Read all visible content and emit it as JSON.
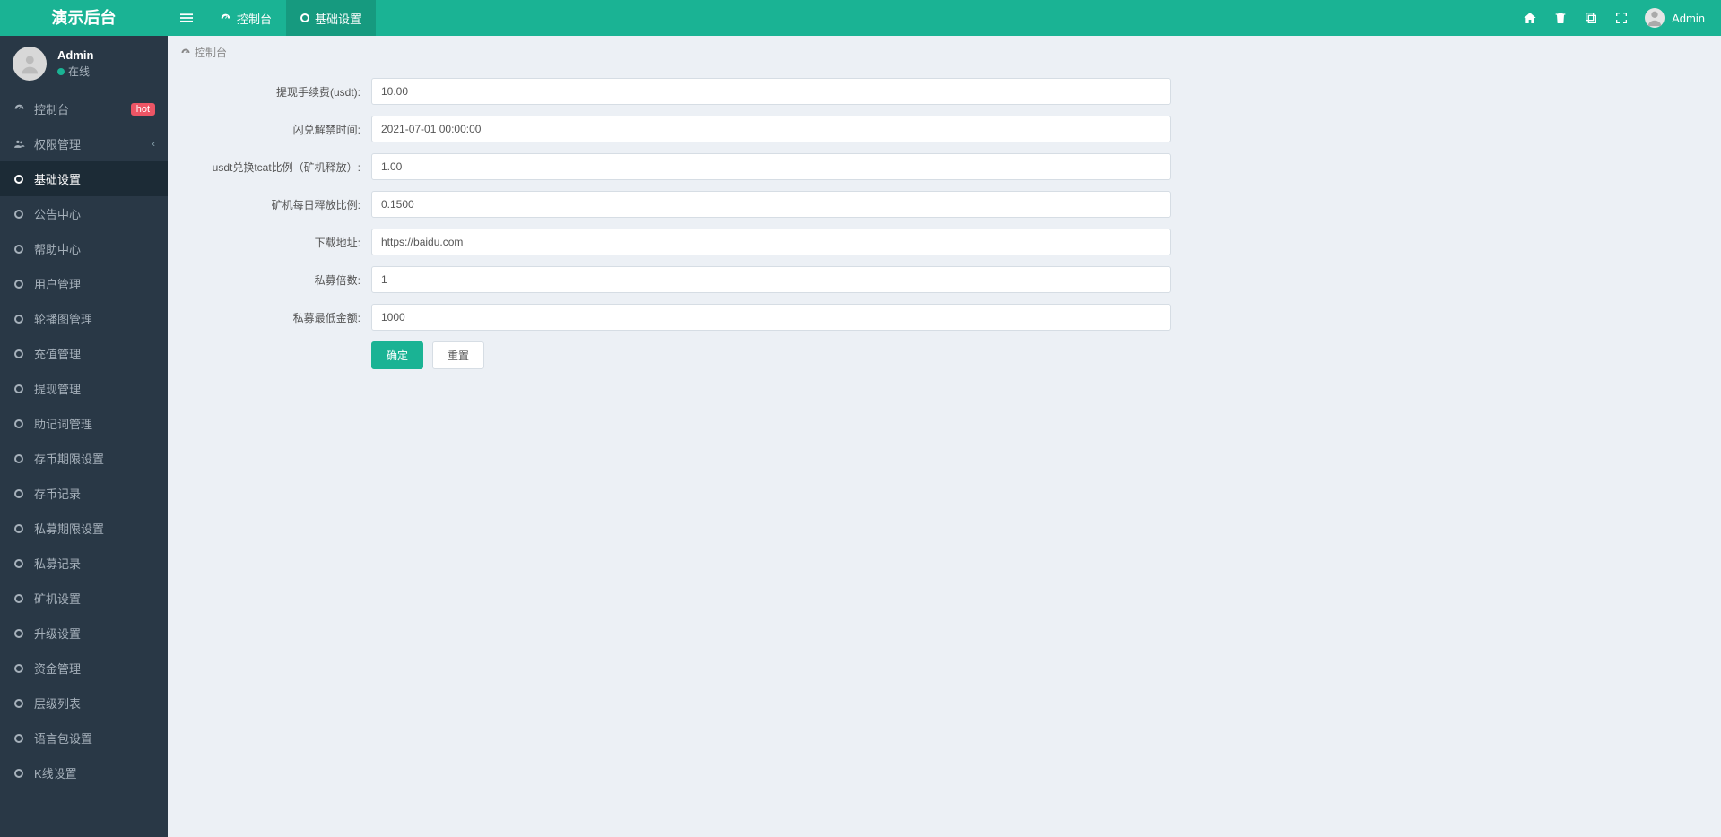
{
  "brand": "演示后台",
  "topbar": {
    "tabs": [
      {
        "label": "控制台",
        "icon": "dashboard"
      },
      {
        "label": "基础设置",
        "icon": "circle"
      }
    ],
    "user": "Admin"
  },
  "user_panel": {
    "name": "Admin",
    "status": "在线"
  },
  "sidebar": [
    {
      "label": "控制台",
      "icon": "dashboard",
      "badge": "hot"
    },
    {
      "label": "权限管理",
      "icon": "users",
      "expandable": true
    },
    {
      "label": "基础设置",
      "icon": "circle",
      "active": true
    },
    {
      "label": "公告中心",
      "icon": "circle"
    },
    {
      "label": "帮助中心",
      "icon": "circle"
    },
    {
      "label": "用户管理",
      "icon": "circle"
    },
    {
      "label": "轮播图管理",
      "icon": "circle"
    },
    {
      "label": "充值管理",
      "icon": "circle"
    },
    {
      "label": "提现管理",
      "icon": "circle"
    },
    {
      "label": "助记词管理",
      "icon": "circle"
    },
    {
      "label": "存币期限设置",
      "icon": "circle"
    },
    {
      "label": "存币记录",
      "icon": "circle"
    },
    {
      "label": "私募期限设置",
      "icon": "circle"
    },
    {
      "label": "私募记录",
      "icon": "circle"
    },
    {
      "label": "矿机设置",
      "icon": "circle"
    },
    {
      "label": "升级设置",
      "icon": "circle"
    },
    {
      "label": "资金管理",
      "icon": "circle"
    },
    {
      "label": "层级列表",
      "icon": "circle"
    },
    {
      "label": "语言包设置",
      "icon": "circle"
    },
    {
      "label": "K线设置",
      "icon": "circle"
    }
  ],
  "breadcrumb": "控制台",
  "form": {
    "fields": [
      {
        "label": "提现手续费(usdt):",
        "value": "10.00"
      },
      {
        "label": "闪兑解禁时间:",
        "value": "2021-07-01 00:00:00"
      },
      {
        "label": "usdt兑换tcat比例（矿机释放）:",
        "value": "1.00"
      },
      {
        "label": "矿机每日释放比例:",
        "value": "0.1500"
      },
      {
        "label": "下载地址:",
        "value": "https://baidu.com"
      },
      {
        "label": "私募倍数:",
        "value": "1"
      },
      {
        "label": "私募最低金额:",
        "value": "1000"
      }
    ],
    "submit": "确定",
    "reset": "重置"
  }
}
